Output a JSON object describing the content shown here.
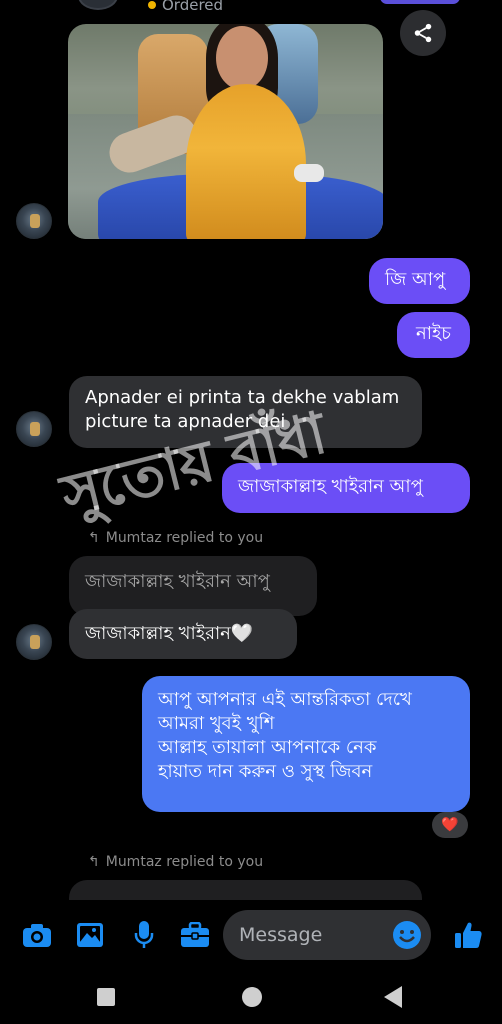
{
  "header": {
    "status_text": "Ordered"
  },
  "messages": {
    "out1": "জি আপু",
    "out2": "নাইচ",
    "in1_line1": "Apnader ei printa ta dekhe vablam",
    "in1_line2": "picture ta apnader dei",
    "out3": "জাজাকাল্লাহ খাইরান আপু",
    "reply1_label": "Mumtaz replied to you",
    "reply1_quote": "জাজাকাল্লাহ খাইরান আপু",
    "reply1_text": "জাজাকাল্লাহ খাইরান🤍",
    "out4_line1": "আপু আপনার এই আন্তরিকতা দেখে",
    "out4_line2": "আমরা খুবই খুশি",
    "out4_line3": "আল্লাহ তায়ালা আপনাকে নেক",
    "out4_line4": "হায়াত দান করুন ও সুস্থ জিবন",
    "reaction": "❤️",
    "reply2_label": "Mumtaz replied to you"
  },
  "watermark": "সুতোয় বাঁধা",
  "composer": {
    "placeholder": "Message"
  },
  "colors": {
    "accent": "#6b4ef6",
    "icon_blue": "#1b8cf2"
  },
  "icons": [
    "camera-icon",
    "gallery-icon",
    "microphone-icon",
    "briefcase-icon",
    "emoji-icon",
    "thumbs-up-icon",
    "share-icon"
  ]
}
